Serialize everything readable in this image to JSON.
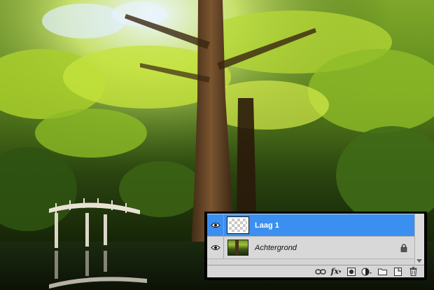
{
  "canvas": {
    "description_icon": "photo-canvas"
  },
  "layers_panel": {
    "layers": [
      {
        "name": "Laag 1",
        "selected": true,
        "visible": true,
        "thumbnail": "transparent",
        "locked": false
      },
      {
        "name": "Achtergrond",
        "selected": false,
        "visible": true,
        "thumbnail": "photo",
        "locked": true
      }
    ],
    "toolbar_icons": [
      {
        "name": "link-layers-icon"
      },
      {
        "name": "layer-style-fx-icon",
        "label": "fx"
      },
      {
        "name": "layer-mask-icon"
      },
      {
        "name": "adjustment-layer-icon"
      },
      {
        "name": "new-group-icon"
      },
      {
        "name": "new-layer-icon"
      },
      {
        "name": "delete-layer-icon"
      }
    ]
  },
  "colors": {
    "selection": "#3b8ff0",
    "panel_bg": "#d4d4d4"
  }
}
